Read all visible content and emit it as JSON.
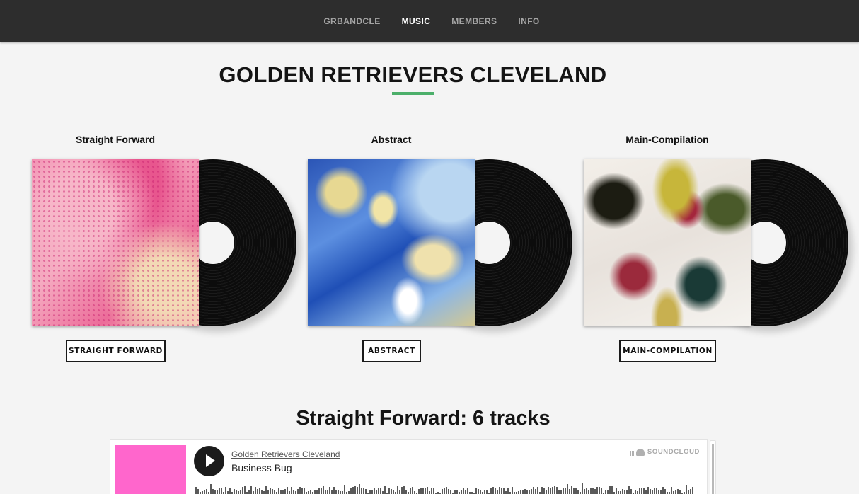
{
  "nav": {
    "items": [
      {
        "label": "GRBANDCLE",
        "active": false
      },
      {
        "label": "MUSIC",
        "active": true
      },
      {
        "label": "MEMBERS",
        "active": false
      },
      {
        "label": "INFO",
        "active": false
      }
    ]
  },
  "page": {
    "title": "GOLDEN RETRIEVERS CLEVELAND",
    "accent_color": "#4caf6a"
  },
  "albums": [
    {
      "name": "Straight Forward",
      "button_label": "STRAIGHT FORWARD"
    },
    {
      "name": "Abstract",
      "button_label": "ABSTRACT"
    },
    {
      "name": "Main-Compilation",
      "button_label": "MAIN-COMPILATION"
    }
  ],
  "tracks_section": {
    "title": "Straight Forward: 6 tracks"
  },
  "player": {
    "artist": "Golden Retrievers Cleveland",
    "track": "Business Bug",
    "brand": "SOUNDCLOUD",
    "artwork_color": "#ff66cc",
    "play_icon": "play-icon",
    "brand_icon": "soundcloud-logo-icon"
  }
}
